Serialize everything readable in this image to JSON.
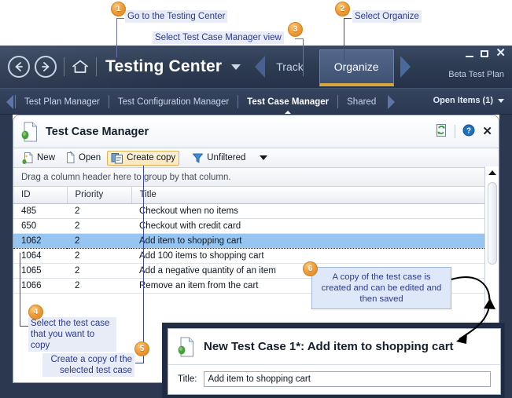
{
  "callouts": [
    {
      "n": "1",
      "text": "Go to the Testing Center"
    },
    {
      "n": "2",
      "text": "Select Organize"
    },
    {
      "n": "3",
      "text": "Select Test Case Manager view"
    },
    {
      "n": "4",
      "text": "Select the test case that you want to copy"
    },
    {
      "n": "5",
      "text": "Create a copy of the selected test case"
    },
    {
      "n": "6",
      "text": "A copy of the test case is created and can be edited and then saved"
    }
  ],
  "titlebar": {
    "back_icon": "arrow-left-icon",
    "forward_icon": "arrow-right-icon",
    "home_icon": "home-icon",
    "app_title": "Testing Center",
    "dropdown_icon": "chevron-down-icon",
    "nav_prev_icon": "triangle-left-icon",
    "nav_next_icon": "triangle-right-icon",
    "items": [
      {
        "label": "Track",
        "selected": false
      },
      {
        "label": "Organize",
        "selected": true
      }
    ],
    "plan_label": "Beta Test Plan",
    "minimize_label": "Minimize",
    "maximize_label": "Maximize",
    "close_label": "✕",
    "accent_color": "#d8a93a",
    "bar_color": "#2e3c52"
  },
  "tabbar": {
    "prev_icon": "triangle-left-icon",
    "next_icon": "triangle-right-icon",
    "tabs": [
      {
        "label": "Test Plan Manager",
        "active": false
      },
      {
        "label": "Test Configuration Manager",
        "active": false
      },
      {
        "label": "Test Case Manager",
        "active": true
      },
      {
        "label": "Shared",
        "active": false
      }
    ],
    "open_items_label": "Open Items (1)"
  },
  "panel": {
    "icon": "test-case-document-icon",
    "title": "Test Case Manager",
    "refresh_label": "Refresh",
    "help_label": "Help",
    "close_label": "✕",
    "toolbar": {
      "new_label": "New",
      "open_label": "Open",
      "create_copy_label": "Create copy",
      "filter_label": "Unfiltered",
      "filter_icon": "funnel-icon",
      "dropdown_icon": "caret-down-icon",
      "highlight_color": "#fae7bd"
    },
    "group_bar_text": "Drag a column header here to group by that column.",
    "grid": {
      "columns": [
        "ID",
        "Priority",
        "Title"
      ],
      "rows": [
        {
          "id": "485",
          "priority": "2",
          "title": "Checkout when no items",
          "selected": false
        },
        {
          "id": "650",
          "priority": "2",
          "title": "Checkout with credit card",
          "selected": false
        },
        {
          "id": "1062",
          "priority": "2",
          "title": "Add item to shopping cart",
          "selected": true
        },
        {
          "id": "1064",
          "priority": "2",
          "title": "Add 100 items to shopping cart",
          "selected": false
        },
        {
          "id": "1065",
          "priority": "2",
          "title": "Add a negative quantity of an item",
          "selected": false
        },
        {
          "id": "1066",
          "priority": "2",
          "title": "Remove an item from the cart",
          "selected": false
        }
      ],
      "selection_color": "#95c5f0"
    },
    "scrollbar": {
      "up_icon": "scroll-up-arrow-icon",
      "down_icon": "scroll-down-arrow-icon"
    }
  },
  "dialog": {
    "icon": "test-case-document-icon",
    "title": "New Test Case 1*: Add item to shopping cart",
    "title_field_label": "Title:",
    "title_field_value": "Add item to shopping cart"
  }
}
